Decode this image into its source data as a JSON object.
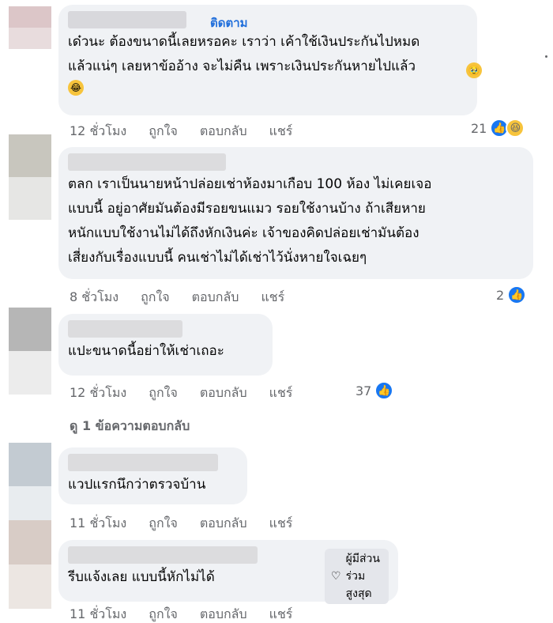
{
  "comments": [
    {
      "follow": "ติดตาม",
      "text": "เด๋วนะ ต้องขนาดนี้เลยหรอคะ เราว่า เค้าใช้เงินประกันไปหมด\nแล้วแน่ๆ เลยหาข้ออ้าง จะไม่คืน เพราะเงินประกันหายไปแล้ว",
      "time": "12 ชั่วโมง",
      "like": "ถูกใจ",
      "reply": "ตอบกลับ",
      "share": "แชร์",
      "count": "21"
    },
    {
      "text": "ตลก เราเป็นนายหน้าปล่อยเช่าห้องมาเกือบ 100 ห้อง ไม่เคยเจอ\nแบบนี้ อยู่อาศัยมันต้องมีรอยขนแมว รอยใช้งานบ้าง ถ้าเสียหาย\nหนักแบบใช้งานไม่ได้ถึงหักเงินค่ะ เจ้าของคิดปล่อยเช่ามันต้อง\nเสี่ยงกับเรื่องแบบนี้ คนเช่าไม่ได้เช่าไว้นั่งหายใจเฉยๆ",
      "time": "8 ชั่วโมง",
      "like": "ถูกใจ",
      "reply": "ตอบกลับ",
      "share": "แชร์",
      "count": "2"
    },
    {
      "text": "แปะขนาดนี้อย่าให้เช่าเถอะ",
      "time": "12 ชั่วโมง",
      "like": "ถูกใจ",
      "reply": "ตอบกลับ",
      "share": "แชร์",
      "count": "37"
    },
    {
      "text": "แวปแรกนึกว่าตรวจบ้าน",
      "time": "11 ชั่วโมง",
      "like": "ถูกใจ",
      "reply": "ตอบกลับ",
      "share": "แชร์"
    },
    {
      "badge": "ผู้มีส่วนร่วมสูงสุด",
      "text": "รีบแจ้งเลย แบบนี้หักไม่ได้",
      "time": "11 ชั่วโมง",
      "like": "ถูกใจ",
      "reply": "ตอบกลับ",
      "share": "แชร์"
    }
  ],
  "view_replies": "ดู 1 ข้อความตอบกลับ",
  "colors": {
    "bubble": "#f0f2f5",
    "link": "#216fdb",
    "meta": "#65676b",
    "like_blue": "#1877f2"
  }
}
